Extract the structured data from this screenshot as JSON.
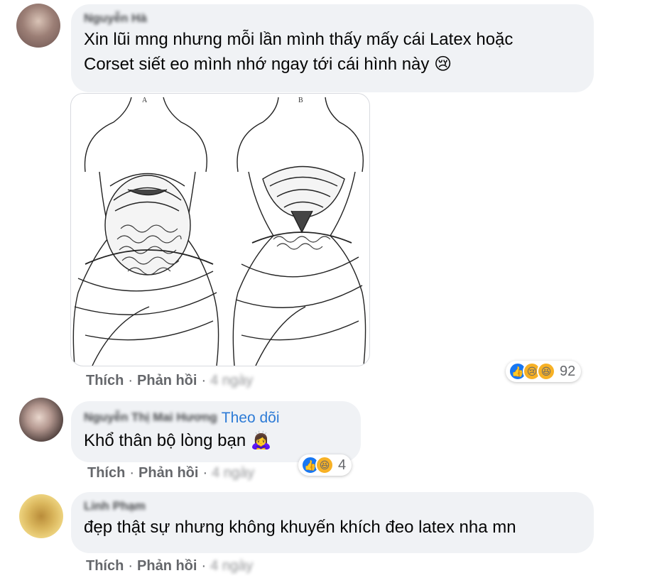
{
  "comments": [
    {
      "author": "Nguyễn Hà",
      "text_line1": "Xin lũi mng nhưng mỗi lần mình thấy mấy cái Latex hoặc",
      "text_line2": "Corset siết eo mình nhớ ngay tới cái hình này 😢",
      "image_labels": [
        "A",
        "B"
      ],
      "actions": {
        "like": "Thích",
        "reply": "Phản hồi",
        "time": "4 ngày"
      },
      "reaction_count": "92",
      "reactions": [
        "like-icon",
        "sad-icon",
        "haha-icon"
      ]
    },
    {
      "author": "Nguyễn Thị Mai Hương",
      "follow": "Theo dõi",
      "text": "Khổ thân bộ lòng bạn 🙇‍♀️",
      "actions": {
        "like": "Thích",
        "reply": "Phản hồi",
        "time": "4 ngày"
      },
      "reaction_count": "4",
      "reactions": [
        "like-icon",
        "haha-icon"
      ]
    },
    {
      "author": "Linh Phạm",
      "text": "đẹp thật sự nhưng không khuyến khích đeo latex nha mn",
      "actions": {
        "like": "Thích",
        "reply": "Phản hồi",
        "time": "4 ngày"
      }
    }
  ],
  "colors": {
    "bubble": "#f0f2f5",
    "link_blue": "#2d7bd6",
    "action_gray": "#65676b",
    "like_blue": "#1877f2",
    "emoji_yellow": "#f7b125"
  }
}
